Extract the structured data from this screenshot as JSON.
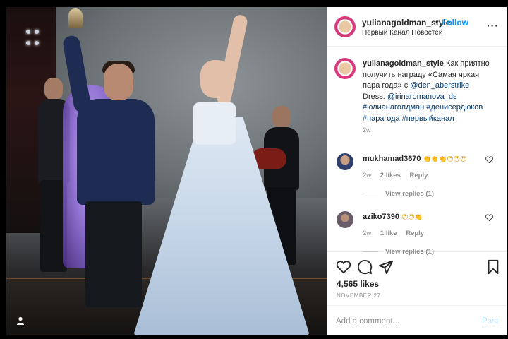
{
  "post_header": {
    "username": "yulianagoldman_style",
    "separator": "•",
    "follow_label": "Follow",
    "location": "Первый Канал Новостей",
    "more_icon": "more-options-icon",
    "more_glyph": "···"
  },
  "caption": {
    "username": "yulianagoldman_style",
    "text_1": " Как приятно",
    "text_2": "получить награду «Самая яркая",
    "text_3": "пара года» с ",
    "mention_1": "@den_aberstrike",
    "text_4": "Dress: ",
    "mention_2": "@irinaromanova_ds",
    "hashtags_1": "#юлианаголдман #денисердюков",
    "hashtags_2": "#парагода #первыйканал",
    "time": "2w"
  },
  "comments": [
    {
      "username": "mukhamad3670",
      "emoji": "👏👏👏😍😍😍",
      "time": "2w",
      "likes": "2 likes",
      "reply_label": "Reply",
      "view_replies": "View replies (1)"
    },
    {
      "username": "aziko7390",
      "emoji": "😍😍👏",
      "time": "2w",
      "likes": "1 like",
      "reply_label": "Reply",
      "view_replies": "View replies (1)"
    }
  ],
  "actions": {
    "like_icon": "heart-icon",
    "comment_icon": "comment-icon",
    "share_icon": "share-icon",
    "save_icon": "bookmark-icon",
    "likes_count": "4,565 likes",
    "date": "NOVEMBER 27"
  },
  "add_comment": {
    "placeholder": "Add a comment...",
    "post_label": "Post"
  },
  "photo": {
    "user_tag_icon": "user-tag-icon",
    "user_tag_glyph": "👤"
  },
  "colors": {
    "accent": "#0095f6",
    "text": "#262626",
    "muted": "#8e8e8e",
    "link": "#00376b"
  }
}
